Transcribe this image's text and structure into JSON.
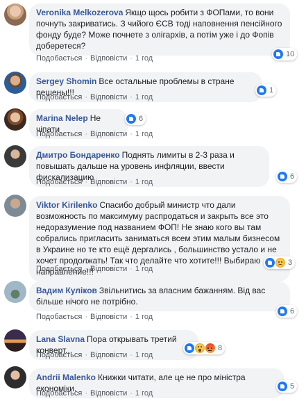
{
  "common": {
    "reply_label": "Подобається",
    "answer_label": "Відповісти",
    "dot": "·",
    "time": "1 год"
  },
  "comments": [
    {
      "author": "Veronika Melkozerova",
      "text": "Якщо щось робити з ФОПами, то вони почнуть закриватись. З чийого ЄСВ тоді наповнення пенсійного фонду буде? Може почнете з олігархів, а потім уже і до Фопів доберетеся?",
      "reactions": [
        "like"
      ],
      "count": "10"
    },
    {
      "author": "Sergey Shomin",
      "text": "Все остальные проблемы в стране решены!!!",
      "reactions": [
        "like"
      ],
      "count": "1"
    },
    {
      "author": "Marina Nelep",
      "text": "Не чіпати",
      "reactions": [
        "like"
      ],
      "count": "6"
    },
    {
      "author": "Дмитро Бондаренко",
      "text": "Поднять лимиты в 2-3 раза и повышать дальше на уровень инфляции, ввести фискализацию",
      "reactions": [
        "like"
      ],
      "count": "6"
    },
    {
      "author": "Viktor Kirilenko",
      "text": "Спасибо добрый министр что дали возможность по максимуму распродаться и закрыть все это недоразумение под названием ФОП! Не знаю кого вы там собрались пригласить заниматься всем этим малым бизнесом в Украине но те кто ещё дергались , большинство устало и не хочет продолжать! Так что делайте что хотите!!! Выбираю направление!!!",
      "reactions": [
        "like",
        "sad"
      ],
      "count": "3"
    },
    {
      "author": "Вадим Куліков",
      "text": "Звільнитись за власним бажанням. Від вас більше нічого не потрібно.",
      "reactions": [
        "like"
      ],
      "count": "6"
    },
    {
      "author": "Lana Slavna",
      "text": "Пора открывать третий конверт...",
      "reactions": [
        "like",
        "wow",
        "angry"
      ],
      "count": "8"
    },
    {
      "author": "Andrii Malenko",
      "text": "Книжки читати, але це не про міністра економіки.",
      "reactions": [
        "like"
      ],
      "count": "5"
    }
  ]
}
